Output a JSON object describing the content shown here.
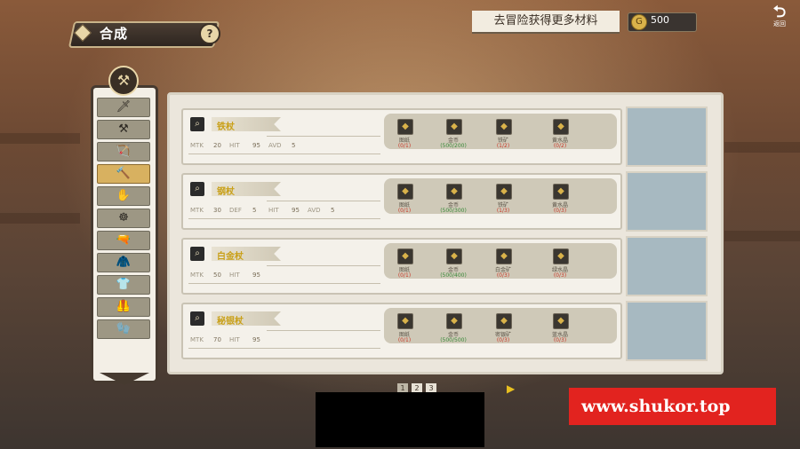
{
  "header": {
    "title": "合成",
    "help": "?",
    "hint": "去冒险获得更多材料",
    "gold_icon": "coin-icon",
    "gold_amount": "500",
    "back_label": "返回",
    "back_glyph": "⮌"
  },
  "categories": [
    {
      "icon": "🗡",
      "active": false
    },
    {
      "icon": "⚒",
      "active": false
    },
    {
      "icon": "🏹",
      "active": false
    },
    {
      "icon": "🔨",
      "active": true
    },
    {
      "icon": "✋",
      "active": false
    },
    {
      "icon": "☸",
      "active": false
    },
    {
      "icon": "🔫",
      "active": false
    },
    {
      "icon": "🧥",
      "active": false
    },
    {
      "icon": "👕",
      "active": false
    },
    {
      "icon": "🦺",
      "active": false
    },
    {
      "icon": "🧤",
      "active": false
    }
  ],
  "recipes": [
    {
      "name": "铁杖",
      "stats": [
        [
          "MTK",
          "20"
        ],
        [
          "HIT",
          "95"
        ],
        [
          "AVD",
          "5"
        ]
      ],
      "materials": [
        {
          "name": "图纸",
          "req": "(0/1)",
          "met": false
        },
        {
          "name": "金币",
          "req": "(500/200)",
          "met": true
        },
        {
          "name": "铁矿",
          "req": "(1/2)",
          "met": false
        },
        {
          "name": "黄水晶",
          "req": "(0/2)",
          "met": false
        }
      ]
    },
    {
      "name": "钢杖",
      "stats": [
        [
          "MTK",
          "30"
        ],
        [
          "DEF",
          "5"
        ],
        [
          "HIT",
          "95"
        ],
        [
          "AVD",
          "5"
        ]
      ],
      "materials": [
        {
          "name": "图纸",
          "req": "(0/1)",
          "met": false
        },
        {
          "name": "金币",
          "req": "(500/300)",
          "met": true
        },
        {
          "name": "铁矿",
          "req": "(1/3)",
          "met": false
        },
        {
          "name": "黄水晶",
          "req": "(0/3)",
          "met": false
        }
      ]
    },
    {
      "name": "白金杖",
      "stats": [
        [
          "MTK",
          "50"
        ],
        [
          "HIT",
          "95"
        ]
      ],
      "materials": [
        {
          "name": "图纸",
          "req": "(0/1)",
          "met": false
        },
        {
          "name": "金币",
          "req": "(500/400)",
          "met": true
        },
        {
          "name": "白金矿",
          "req": "(0/3)",
          "met": false
        },
        {
          "name": "绿水晶",
          "req": "(0/3)",
          "met": false
        }
      ]
    },
    {
      "name": "秘银杖",
      "stats": [
        [
          "MTK",
          "70"
        ],
        [
          "HIT",
          "95"
        ]
      ],
      "materials": [
        {
          "name": "图纸",
          "req": "(0/1)",
          "met": false
        },
        {
          "name": "金币",
          "req": "(500/500)",
          "met": true
        },
        {
          "name": "密银矿",
          "req": "(0/3)",
          "met": false
        },
        {
          "name": "蓝水晶",
          "req": "(0/3)",
          "met": false
        }
      ]
    }
  ],
  "pagination": {
    "pages": [
      "1",
      "2",
      "3"
    ],
    "current": "1",
    "next": "▶"
  },
  "watermark": "www.shukor.top"
}
